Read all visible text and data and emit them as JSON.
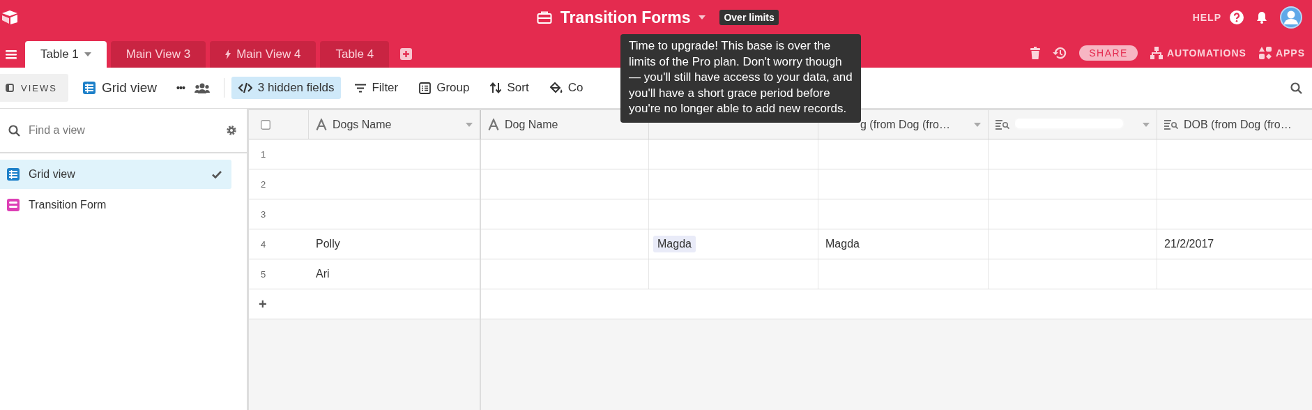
{
  "app_bar": {
    "title": "Transition Forms",
    "badge": "Over limits",
    "help": "HELP"
  },
  "tabs": [
    {
      "label": "Table 1",
      "selected": true,
      "kind": "table"
    },
    {
      "label": "Main View 3",
      "selected": false,
      "kind": "table"
    },
    {
      "label": "Main View 4",
      "selected": false,
      "kind": "synced"
    },
    {
      "label": "Table 4",
      "selected": false,
      "kind": "table"
    }
  ],
  "tab_actions": {
    "share": "SHARE",
    "automations": "AUTOMATIONS",
    "apps": "APPS"
  },
  "toolbar": {
    "views": "VIEWS",
    "view_name": "Grid view",
    "more": "•••",
    "hidden_fields": "3 hidden fields",
    "filter": "Filter",
    "group": "Group",
    "sort": "Sort",
    "color_button": "Co"
  },
  "tooltip": "Time to upgrade! This base is over the limits of the Pro plan. Don't worry though — you'll still have access to your data, and you'll have a short grace period before you're no longer able to add new records.",
  "sidebar": {
    "search_placeholder": "Find a view",
    "views": [
      {
        "label": "Grid view",
        "kind": "grid",
        "selected": true
      },
      {
        "label": "Transition Form",
        "kind": "form",
        "selected": false
      }
    ]
  },
  "table": {
    "select_all_checked": false,
    "columns": [
      {
        "label": "Dogs Name",
        "caret": true,
        "kind": "text"
      },
      {
        "label": "Dog Name",
        "caret": false,
        "kind": "text"
      },
      {
        "caret": false,
        "kind": "link"
      },
      {
        "label": "g (from Dog (fro…",
        "caret": true,
        "kind": "partial"
      },
      {
        "caret": true,
        "kind": "lookup"
      },
      {
        "label": "DOB (from Dog (fro…",
        "caret": false,
        "kind": "lookup"
      }
    ],
    "rows": [
      {
        "number": "1"
      },
      {
        "number": "2"
      },
      {
        "number": "3"
      },
      {
        "number": "4",
        "column_1": "Polly",
        "column_3": "Magda",
        "column_4": "Magda",
        "column_6": "21/2/2017"
      },
      {
        "number": "5",
        "column_1": "Ari"
      }
    ],
    "add_row": "+"
  }
}
